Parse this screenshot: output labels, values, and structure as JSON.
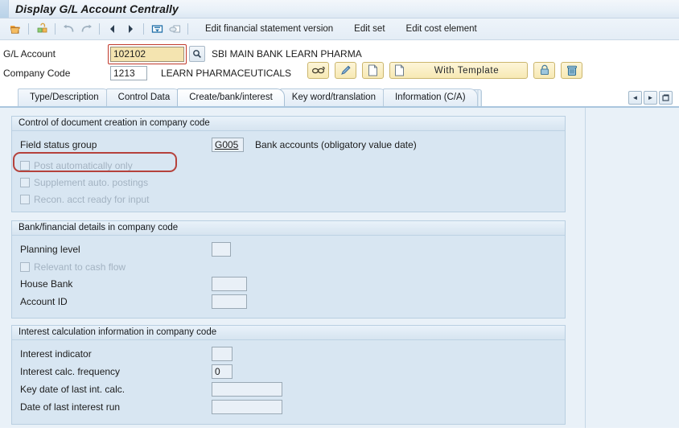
{
  "window": {
    "title": "Display G/L Account Centrally"
  },
  "toolbar": {
    "icons": [
      {
        "name": "open-folder-icon"
      },
      {
        "name": "lock-folder-icon"
      },
      {
        "name": "undo-icon"
      },
      {
        "name": "redo-icon"
      },
      {
        "name": "previous-arrow-icon"
      },
      {
        "name": "next-arrow-icon"
      },
      {
        "name": "print-icon"
      },
      {
        "name": "overview-icon"
      }
    ],
    "links": [
      "Edit financial statement version",
      "Edit set",
      "Edit cost element"
    ]
  },
  "header": {
    "gl_account_label": "G/L Account",
    "gl_account_value": "102102",
    "gl_account_description": "SBI MAIN BANK LEARN PHARMA",
    "company_code_label": "Company Code",
    "company_code_value": "1213",
    "company_code_description": "LEARN PHARMACEUTICALS",
    "buttons": {
      "display_label": "",
      "edit_label": "",
      "create_label": "",
      "with_template_label": "With Template",
      "lock_label": "",
      "delete_label": ""
    }
  },
  "tabs": [
    {
      "label": "Type/Description",
      "active": false
    },
    {
      "label": "Control Data",
      "active": false
    },
    {
      "label": "Create/bank/interest",
      "active": true
    },
    {
      "label": "Key word/translation",
      "active": false
    },
    {
      "label": "Information (C/A)",
      "active": false
    }
  ],
  "tab_nav": {
    "prev": "◄",
    "next": "►",
    "list": "❐"
  },
  "groups": [
    {
      "title": "Control of document creation in company code",
      "fields": [
        {
          "label": "Field status group",
          "value": "G005",
          "description": "Bank accounts (obligatory value date)"
        }
      ],
      "checkboxes": [
        {
          "label": "Post automatically only",
          "checked": false,
          "highlighted": true
        },
        {
          "label": "Supplement auto. postings",
          "checked": false,
          "highlighted": false
        },
        {
          "label": "Recon. acct ready for input",
          "checked": false,
          "highlighted": false
        }
      ]
    },
    {
      "title": "Bank/financial details in company code",
      "fields": [
        {
          "label": "Planning level",
          "value": "",
          "description": ""
        },
        {
          "label": "House Bank",
          "value": "",
          "description": ""
        },
        {
          "label": "Account ID",
          "value": "",
          "description": ""
        }
      ],
      "checkboxes": [
        {
          "label": "Relevant to cash flow",
          "checked": false,
          "highlighted": false
        }
      ]
    },
    {
      "title": "Interest calculation information in company code",
      "fields": [
        {
          "label": "Interest indicator",
          "value": "",
          "description": ""
        },
        {
          "label": "Interest calc. frequency",
          "value": "0",
          "description": ""
        },
        {
          "label": "Key date of last int. calc.",
          "value": "",
          "description": ""
        },
        {
          "label": "Date of last interest run",
          "value": "",
          "description": ""
        }
      ],
      "checkboxes": []
    }
  ],
  "colors": {
    "accent_blue": "#aac6de",
    "content_bg": "#e9f1f8",
    "group_bg": "#d8e6f2",
    "highlight_red": "#b5423c",
    "focus_field_yellow": "#f4e4b0",
    "button_yellow": "#f7e9b4"
  }
}
